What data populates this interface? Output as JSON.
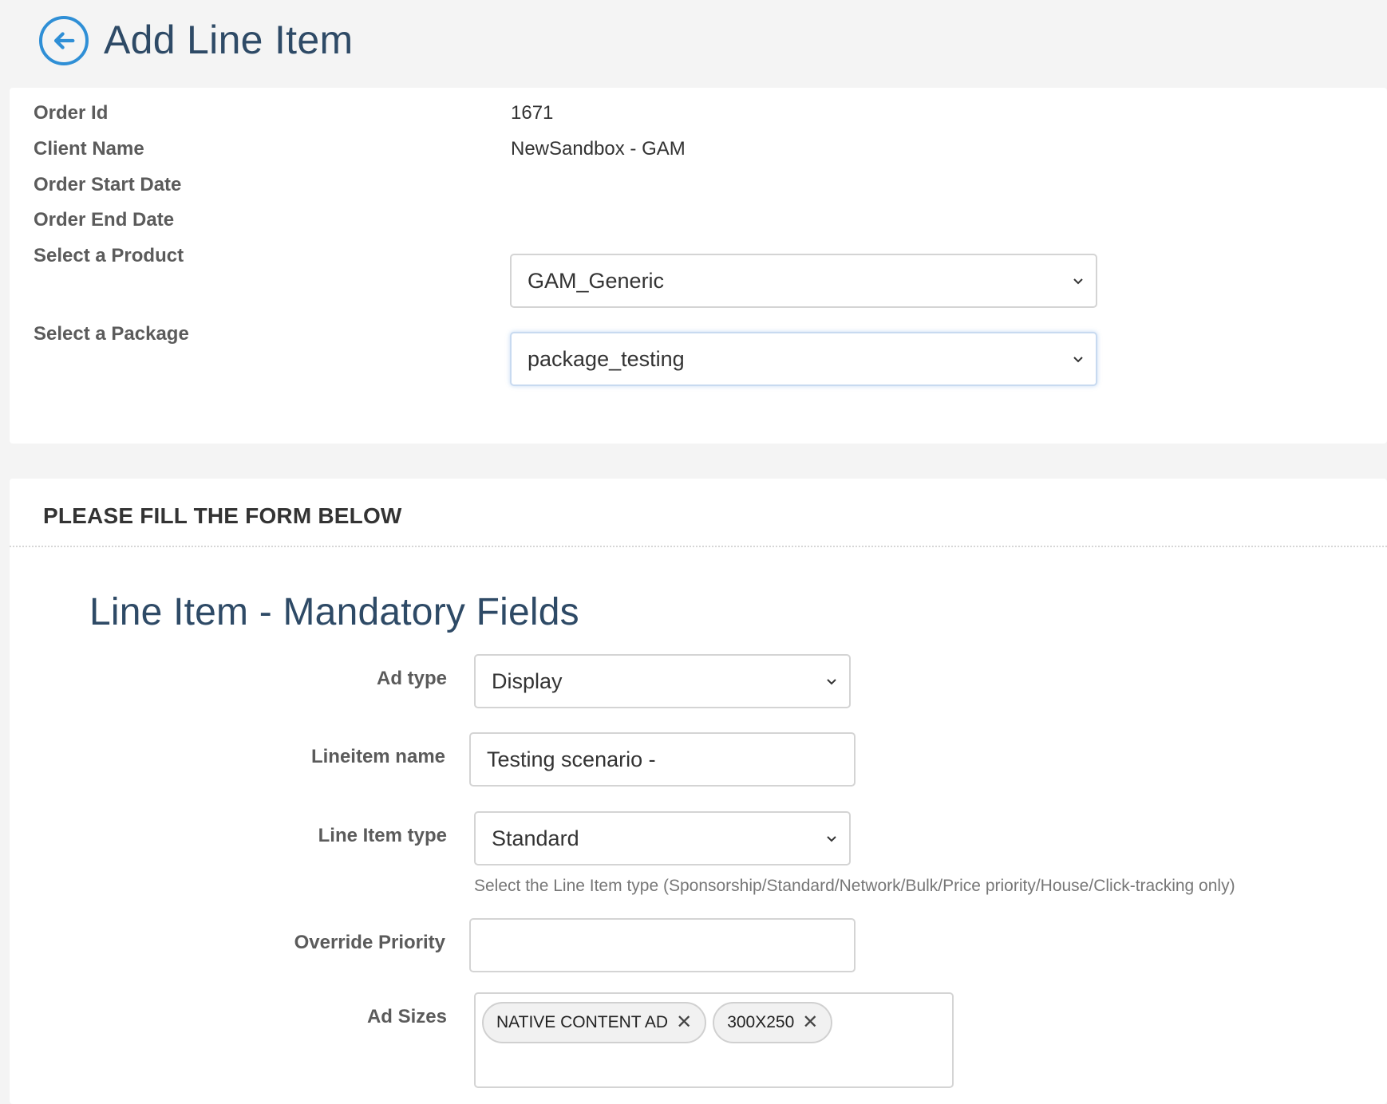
{
  "header": {
    "title": "Add Line Item",
    "back_icon": "arrow-left-circle-icon"
  },
  "order_info": {
    "order_id_label": "Order Id",
    "order_id_value": "1671",
    "client_name_label": "Client Name",
    "client_name_value": "NewSandbox - GAM",
    "start_date_label": "Order Start Date",
    "end_date_label": "Order End Date",
    "product_label": "Select a Product",
    "product_value": "GAM_Generic",
    "package_label": "Select a Package",
    "package_value": "package_testing"
  },
  "form": {
    "header": "PLEASE FILL THE FORM BELOW",
    "section_title": "Line Item - Mandatory Fields",
    "ad_type_label": "Ad type",
    "ad_type_value": "Display",
    "lineitem_name_label": "Lineitem name",
    "lineitem_name_value": "Testing scenario -",
    "line_item_type_label": "Line Item type",
    "line_item_type_value": "Standard",
    "line_item_type_help": "Select the Line Item type (Sponsorship/Standard/Network/Bulk/Price priority/House/Click-tracking only)",
    "override_priority_label": "Override Priority",
    "override_priority_value": "",
    "ad_sizes_label": "Ad Sizes",
    "ad_sizes": [
      "NATIVE CONTENT AD",
      "300X250"
    ]
  },
  "colors": {
    "accent": "#2f8fd6",
    "title": "#2e4a66",
    "background": "#f4f4f4"
  }
}
